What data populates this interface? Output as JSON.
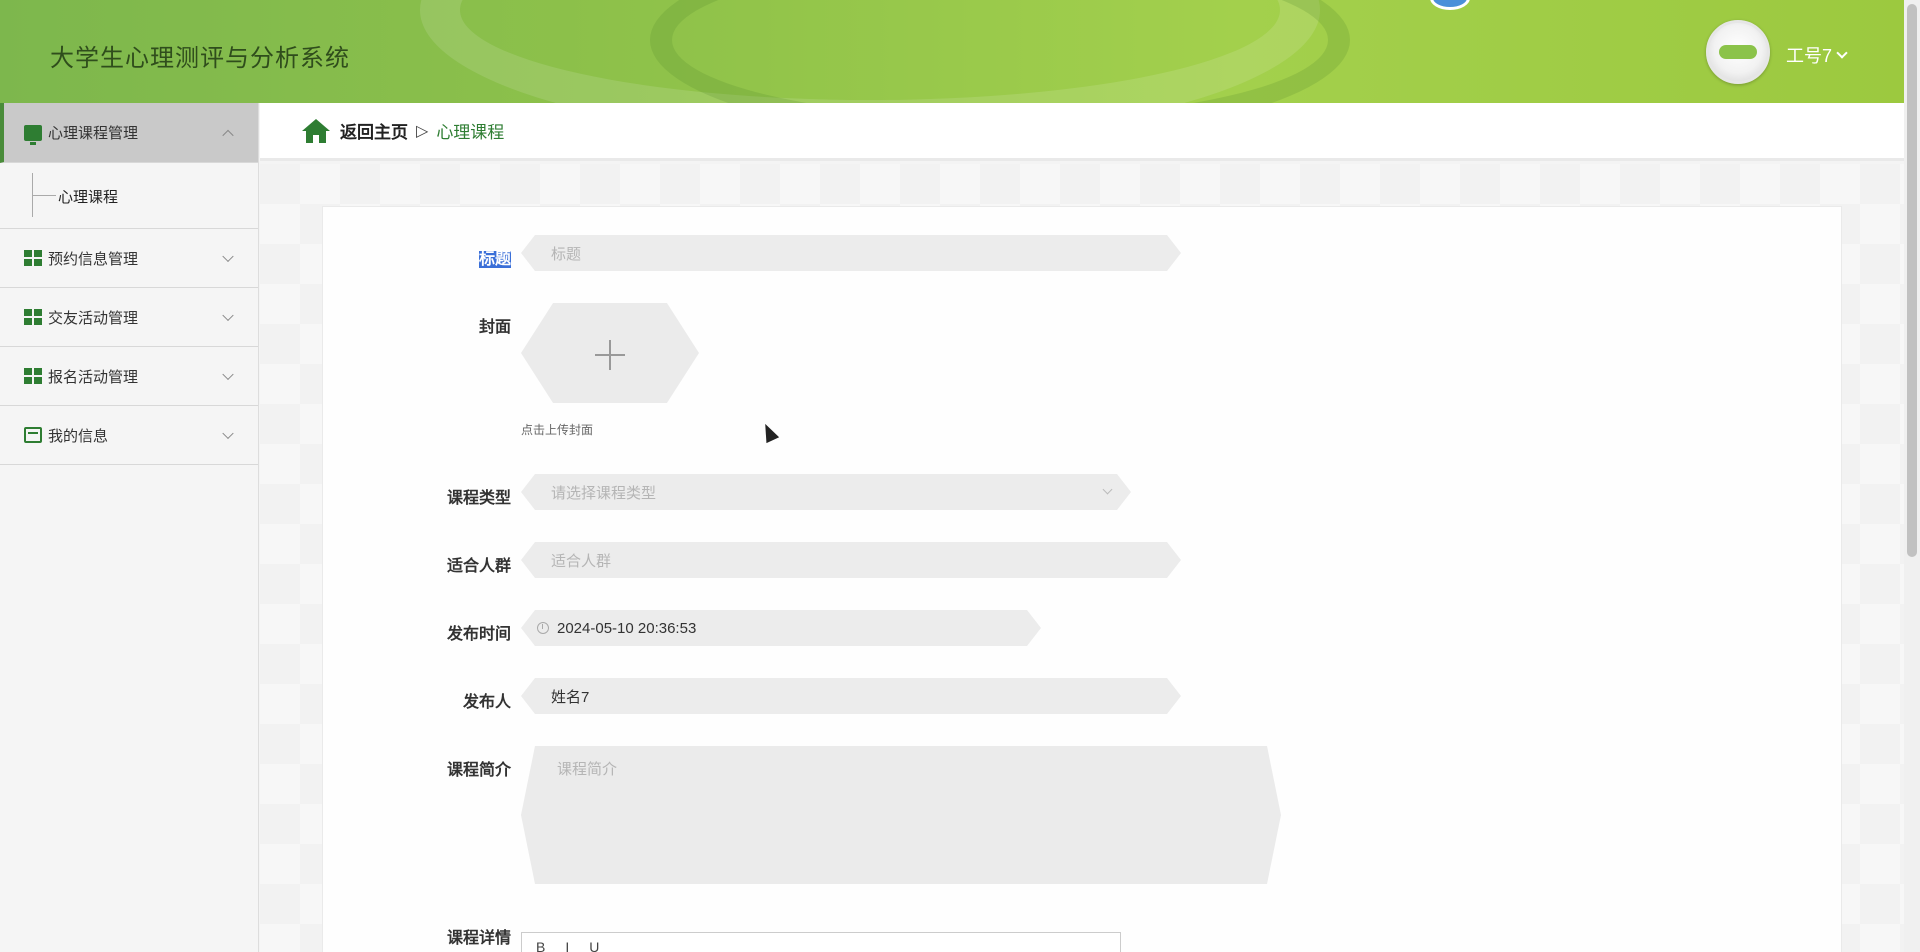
{
  "header": {
    "app_title": "大学生心理测评与分析系统",
    "user_name": "工号7"
  },
  "sidebar": {
    "items": [
      {
        "label": "心理课程管理",
        "icon": "monitor-icon",
        "expanded": true
      },
      {
        "label": "预约信息管理",
        "icon": "grid-icon",
        "expanded": false
      },
      {
        "label": "交友活动管理",
        "icon": "grid-icon",
        "expanded": false
      },
      {
        "label": "报名活动管理",
        "icon": "grid-icon",
        "expanded": false
      },
      {
        "label": "我的信息",
        "icon": "card-icon",
        "expanded": false
      }
    ],
    "subitems": [
      {
        "label": "心理课程"
      }
    ]
  },
  "breadcrumb": {
    "home": "返回主页",
    "separator": "▷",
    "current": "心理课程"
  },
  "form": {
    "title": {
      "label": "标题",
      "placeholder": "标题"
    },
    "cover": {
      "label": "封面",
      "hint": "点击上传封面"
    },
    "course_type": {
      "label": "课程类型",
      "placeholder": "请选择课程类型"
    },
    "audience": {
      "label": "适合人群",
      "placeholder": "适合人群"
    },
    "publish_time": {
      "label": "发布时间",
      "value": "2024-05-10 20:36:53"
    },
    "publisher": {
      "label": "发布人",
      "value": "姓名7"
    },
    "intro": {
      "label": "课程简介",
      "placeholder": "课程简介"
    },
    "detail": {
      "label": "课程详情"
    }
  },
  "colors": {
    "accent": "#2e7d32",
    "header": "#8fc24a"
  }
}
